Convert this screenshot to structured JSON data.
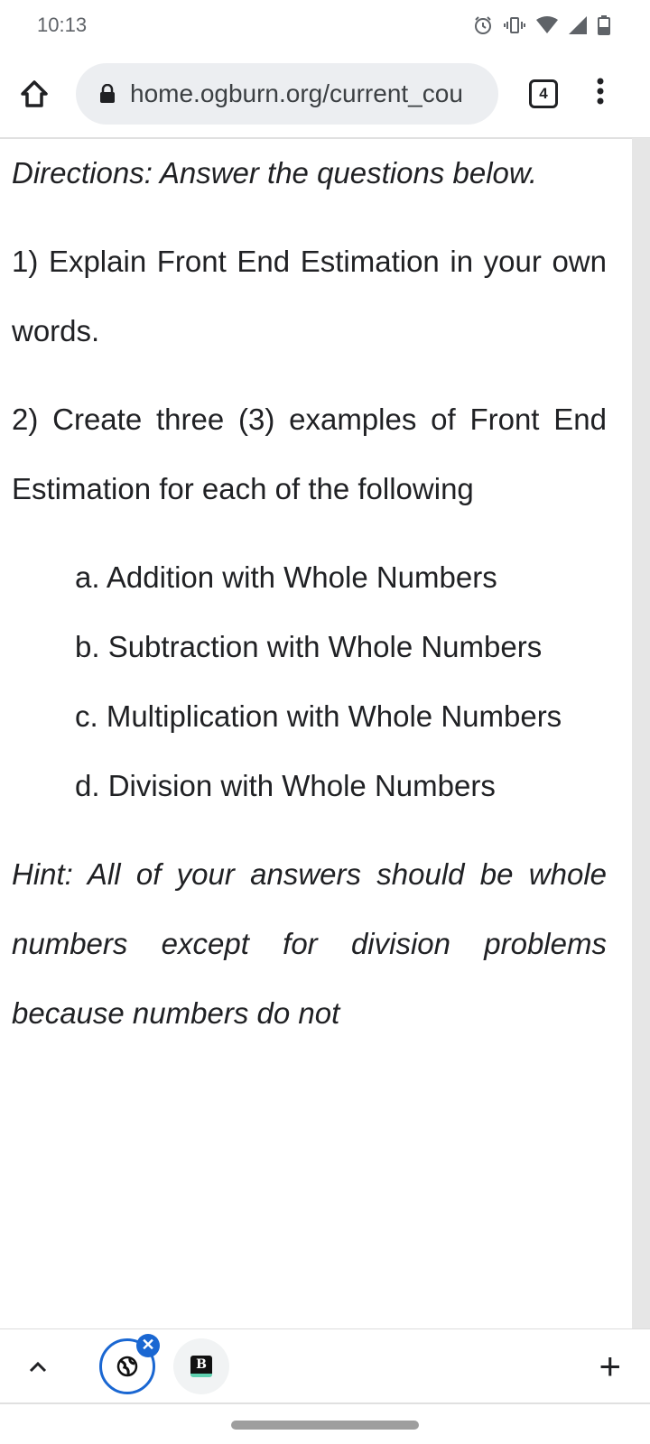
{
  "status": {
    "time": "10:13",
    "icons": [
      "alarm-icon",
      "vibrate-icon",
      "wifi-icon",
      "signal-icon",
      "battery-icon"
    ]
  },
  "browser": {
    "url": "home.ogburn.org/current_cou",
    "tab_count": "4"
  },
  "content": {
    "directions": "Directions: Answer the questions below.",
    "q1": "1) Explain Front End Estimation in your own words.",
    "q2": "2) Create three (3) examples of Front End Estimation for each of the following",
    "items": [
      "a. Addition with Whole Numbers",
      "b. Subtraction with Whole Numbers",
      "c. Multiplication with Whole Numbers",
      "d. Division with Whole Numbers"
    ],
    "hint": "Hint: All of your answers should be whole numbers except for division problems because numbers do not"
  },
  "bottom_bar": {
    "tab_group": [
      "globe-icon",
      "b-favicon"
    ]
  }
}
